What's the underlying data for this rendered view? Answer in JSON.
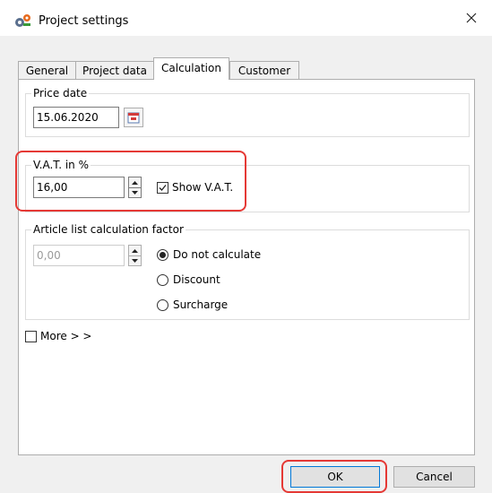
{
  "window": {
    "title": "Project settings"
  },
  "tabs": [
    {
      "label": "General",
      "active": false
    },
    {
      "label": "Project data",
      "active": false
    },
    {
      "label": "Calculation",
      "active": true
    },
    {
      "label": "Customer",
      "active": false
    }
  ],
  "price_date": {
    "legend": "Price date",
    "value": "15.06.2020"
  },
  "vat": {
    "legend": "V.A.T. in %",
    "value": "16,00",
    "show_vat_label": "Show V.A.T.",
    "show_vat_checked": true
  },
  "article_factor": {
    "legend": "Article list calculation factor",
    "value": "0,00",
    "options": [
      {
        "label": "Do not calculate",
        "selected": true
      },
      {
        "label": "Discount",
        "selected": false
      },
      {
        "label": "Surcharge",
        "selected": false
      }
    ]
  },
  "more": {
    "label": "More > >",
    "checked": false
  },
  "buttons": {
    "ok": "OK",
    "cancel": "Cancel"
  },
  "colors": {
    "highlight": "#e53935",
    "accent": "#0078d7"
  }
}
